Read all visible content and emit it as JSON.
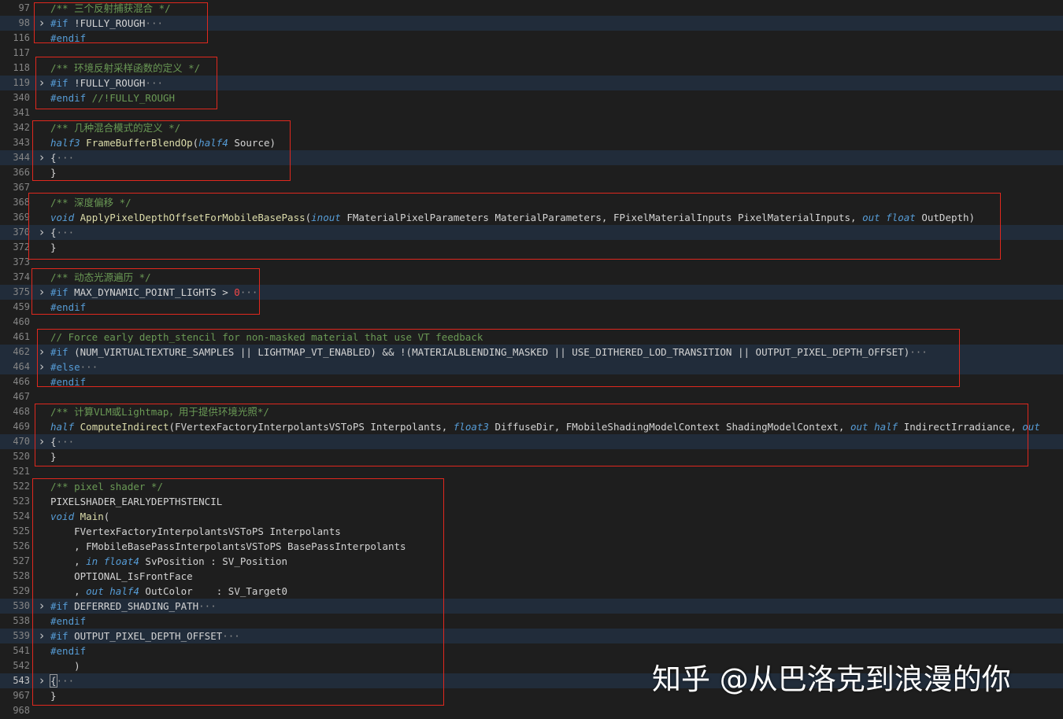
{
  "editor": {
    "lines": [
      {
        "ln": "97",
        "fold": false,
        "tokens": [
          {
            "t": "/** 三个反射捕获混合 */",
            "c": "comment"
          }
        ]
      },
      {
        "ln": "98",
        "fold": true,
        "tokens": [
          {
            "t": "#if",
            "c": "keyword"
          },
          {
            "t": " !FULLY_ROUGH",
            "c": "plain"
          },
          {
            "t": "···",
            "c": "ellipsis"
          }
        ]
      },
      {
        "ln": "116",
        "fold": false,
        "tokens": [
          {
            "t": "#endif",
            "c": "keyword"
          }
        ]
      },
      {
        "ln": "117",
        "fold": false,
        "tokens": []
      },
      {
        "ln": "118",
        "fold": false,
        "tokens": [
          {
            "t": "/** 环境反射采样函数的定义 */",
            "c": "comment"
          }
        ]
      },
      {
        "ln": "119",
        "fold": true,
        "tokens": [
          {
            "t": "#if",
            "c": "keyword"
          },
          {
            "t": " !FULLY_ROUGH",
            "c": "plain"
          },
          {
            "t": "···",
            "c": "ellipsis"
          }
        ]
      },
      {
        "ln": "340",
        "fold": false,
        "tokens": [
          {
            "t": "#endif",
            "c": "keyword"
          },
          {
            "t": " //!FULLY_ROUGH",
            "c": "comment"
          }
        ]
      },
      {
        "ln": "341",
        "fold": false,
        "tokens": []
      },
      {
        "ln": "342",
        "fold": false,
        "tokens": [
          {
            "t": "/** 几种混合模式的定义 */",
            "c": "comment"
          }
        ]
      },
      {
        "ln": "343",
        "fold": false,
        "tokens": [
          {
            "t": "half3",
            "c": "type"
          },
          {
            "t": " ",
            "c": "plain"
          },
          {
            "t": "FrameBufferBlendOp",
            "c": "func"
          },
          {
            "t": "(",
            "c": "plain"
          },
          {
            "t": "half4",
            "c": "type"
          },
          {
            "t": " Source)",
            "c": "plain"
          }
        ]
      },
      {
        "ln": "344",
        "fold": true,
        "tokens": [
          {
            "t": "{",
            "c": "plain"
          },
          {
            "t": "···",
            "c": "ellipsis"
          }
        ]
      },
      {
        "ln": "366",
        "fold": false,
        "tokens": [
          {
            "t": "}",
            "c": "plain"
          }
        ]
      },
      {
        "ln": "367",
        "fold": false,
        "tokens": []
      },
      {
        "ln": "368",
        "fold": false,
        "tokens": [
          {
            "t": "/** 深度偏移 */",
            "c": "comment"
          }
        ]
      },
      {
        "ln": "369",
        "fold": false,
        "tokens": [
          {
            "t": "void",
            "c": "type"
          },
          {
            "t": " ",
            "c": "plain"
          },
          {
            "t": "ApplyPixelDepthOffsetForMobileBasePass",
            "c": "func"
          },
          {
            "t": "(",
            "c": "plain"
          },
          {
            "t": "inout",
            "c": "type"
          },
          {
            "t": " FMaterialPixelParameters MaterialParameters, FPixelMaterialInputs PixelMaterialInputs, ",
            "c": "plain"
          },
          {
            "t": "out",
            "c": "type"
          },
          {
            "t": " ",
            "c": "plain"
          },
          {
            "t": "float",
            "c": "type"
          },
          {
            "t": " OutDepth)",
            "c": "plain"
          }
        ]
      },
      {
        "ln": "370",
        "fold": true,
        "tokens": [
          {
            "t": "{",
            "c": "plain"
          },
          {
            "t": "···",
            "c": "ellipsis"
          }
        ]
      },
      {
        "ln": "372",
        "fold": false,
        "tokens": [
          {
            "t": "}",
            "c": "plain"
          }
        ]
      },
      {
        "ln": "373",
        "fold": false,
        "tokens": []
      },
      {
        "ln": "374",
        "fold": false,
        "tokens": [
          {
            "t": "/** 动态光源遍历 */",
            "c": "comment"
          }
        ]
      },
      {
        "ln": "375",
        "fold": true,
        "tokens": [
          {
            "t": "#if",
            "c": "keyword"
          },
          {
            "t": " MAX_DYNAMIC_POINT_LIGHTS > ",
            "c": "plain"
          },
          {
            "t": "0",
            "c": "zero"
          },
          {
            "t": "···",
            "c": "ellipsis"
          }
        ]
      },
      {
        "ln": "459",
        "fold": false,
        "tokens": [
          {
            "t": "#endif",
            "c": "keyword"
          }
        ]
      },
      {
        "ln": "460",
        "fold": false,
        "tokens": []
      },
      {
        "ln": "461",
        "fold": false,
        "tokens": [
          {
            "t": "// Force early depth_stencil for non-masked material that use VT feedback",
            "c": "comment"
          }
        ]
      },
      {
        "ln": "462",
        "fold": true,
        "tokens": [
          {
            "t": "#if",
            "c": "keyword"
          },
          {
            "t": " (NUM_VIRTUALTEXTURE_SAMPLES || LIGHTMAP_VT_ENABLED) && !(MATERIALBLENDING_MASKED || USE_DITHERED_LOD_TRANSITION || OUTPUT_PIXEL_DEPTH_OFFSET)",
            "c": "plain"
          },
          {
            "t": "···",
            "c": "ellipsis"
          }
        ]
      },
      {
        "ln": "464",
        "fold": true,
        "tokens": [
          {
            "t": "#else",
            "c": "keyword"
          },
          {
            "t": "···",
            "c": "ellipsis"
          }
        ]
      },
      {
        "ln": "466",
        "fold": false,
        "tokens": [
          {
            "t": "#endif",
            "c": "keyword"
          }
        ]
      },
      {
        "ln": "467",
        "fold": false,
        "tokens": []
      },
      {
        "ln": "468",
        "fold": false,
        "tokens": [
          {
            "t": "/** 计算VLM或Lightmap，用于提供环境光照*/",
            "c": "comment"
          }
        ]
      },
      {
        "ln": "469",
        "fold": false,
        "tokens": [
          {
            "t": "half",
            "c": "type"
          },
          {
            "t": " ",
            "c": "plain"
          },
          {
            "t": "ComputeIndirect",
            "c": "func"
          },
          {
            "t": "(FVertexFactoryInterpolantsVSToPS Interpolants, ",
            "c": "plain"
          },
          {
            "t": "float3",
            "c": "type"
          },
          {
            "t": " DiffuseDir, FMobileShadingModelContext ShadingModelContext, ",
            "c": "plain"
          },
          {
            "t": "out",
            "c": "type"
          },
          {
            "t": " ",
            "c": "plain"
          },
          {
            "t": "half",
            "c": "type"
          },
          {
            "t": " IndirectIrradiance, ",
            "c": "plain"
          },
          {
            "t": "out",
            "c": "type"
          }
        ]
      },
      {
        "ln": "470",
        "fold": true,
        "tokens": [
          {
            "t": "{",
            "c": "plain"
          },
          {
            "t": "···",
            "c": "ellipsis"
          }
        ]
      },
      {
        "ln": "520",
        "fold": false,
        "tokens": [
          {
            "t": "}",
            "c": "plain"
          }
        ]
      },
      {
        "ln": "521",
        "fold": false,
        "tokens": []
      },
      {
        "ln": "522",
        "fold": false,
        "tokens": [
          {
            "t": "/** pixel shader */",
            "c": "comment"
          }
        ]
      },
      {
        "ln": "523",
        "fold": false,
        "tokens": [
          {
            "t": "PIXELSHADER_EARLYDEPTHSTENCIL",
            "c": "plain"
          }
        ]
      },
      {
        "ln": "524",
        "fold": false,
        "tokens": [
          {
            "t": "void",
            "c": "type"
          },
          {
            "t": " ",
            "c": "plain"
          },
          {
            "t": "Main",
            "c": "func"
          },
          {
            "t": "(",
            "c": "plain"
          }
        ]
      },
      {
        "ln": "525",
        "fold": false,
        "tokens": [
          {
            "t": "    FVertexFactoryInterpolantsVSToPS Interpolants",
            "c": "plain"
          }
        ]
      },
      {
        "ln": "526",
        "fold": false,
        "tokens": [
          {
            "t": "    , FMobileBasePassInterpolantsVSToPS BasePassInterpolants",
            "c": "plain"
          }
        ]
      },
      {
        "ln": "527",
        "fold": false,
        "tokens": [
          {
            "t": "    , ",
            "c": "plain"
          },
          {
            "t": "in",
            "c": "type"
          },
          {
            "t": " ",
            "c": "plain"
          },
          {
            "t": "float4",
            "c": "type"
          },
          {
            "t": " SvPosition : SV_Position",
            "c": "plain"
          }
        ]
      },
      {
        "ln": "528",
        "fold": false,
        "tokens": [
          {
            "t": "    OPTIONAL_IsFrontFace",
            "c": "plain"
          }
        ]
      },
      {
        "ln": "529",
        "fold": false,
        "tokens": [
          {
            "t": "    , ",
            "c": "plain"
          },
          {
            "t": "out",
            "c": "type"
          },
          {
            "t": " ",
            "c": "plain"
          },
          {
            "t": "half4",
            "c": "type"
          },
          {
            "t": " OutColor    : SV_Target0",
            "c": "plain"
          }
        ]
      },
      {
        "ln": "530",
        "fold": true,
        "tokens": [
          {
            "t": "#if",
            "c": "keyword"
          },
          {
            "t": " DEFERRED_SHADING_PATH",
            "c": "plain"
          },
          {
            "t": "···",
            "c": "ellipsis"
          }
        ]
      },
      {
        "ln": "538",
        "fold": false,
        "tokens": [
          {
            "t": "#endif",
            "c": "keyword"
          }
        ]
      },
      {
        "ln": "539",
        "fold": true,
        "tokens": [
          {
            "t": "#if",
            "c": "keyword"
          },
          {
            "t": " OUTPUT_PIXEL_DEPTH_OFFSET",
            "c": "plain"
          },
          {
            "t": "···",
            "c": "ellipsis"
          }
        ]
      },
      {
        "ln": "541",
        "fold": false,
        "tokens": [
          {
            "t": "#endif",
            "c": "keyword"
          }
        ]
      },
      {
        "ln": "542",
        "fold": false,
        "tokens": [
          {
            "t": "    )",
            "c": "plain"
          }
        ]
      },
      {
        "ln": "543",
        "fold": true,
        "active": true,
        "tokens": [
          {
            "t": "{",
            "c": "plain"
          },
          {
            "t": "···",
            "c": "ellipsis"
          }
        ]
      },
      {
        "ln": "967",
        "fold": false,
        "tokens": [
          {
            "t": "}",
            "c": "plain"
          }
        ]
      },
      {
        "ln": "968",
        "fold": false,
        "tokens": []
      }
    ]
  },
  "watermark": {
    "text": "知乎 @从巴洛克到浪漫的你"
  },
  "colors": {
    "background": "#1e1e1e",
    "folded_line": "#212c3a",
    "annotation_box": "#e0281e",
    "comment": "#6a9955",
    "keyword": "#569cd6",
    "function": "#dcdcaa",
    "text": "#d4d4d4"
  },
  "icons": {
    "fold": "chevron-right-icon"
  }
}
